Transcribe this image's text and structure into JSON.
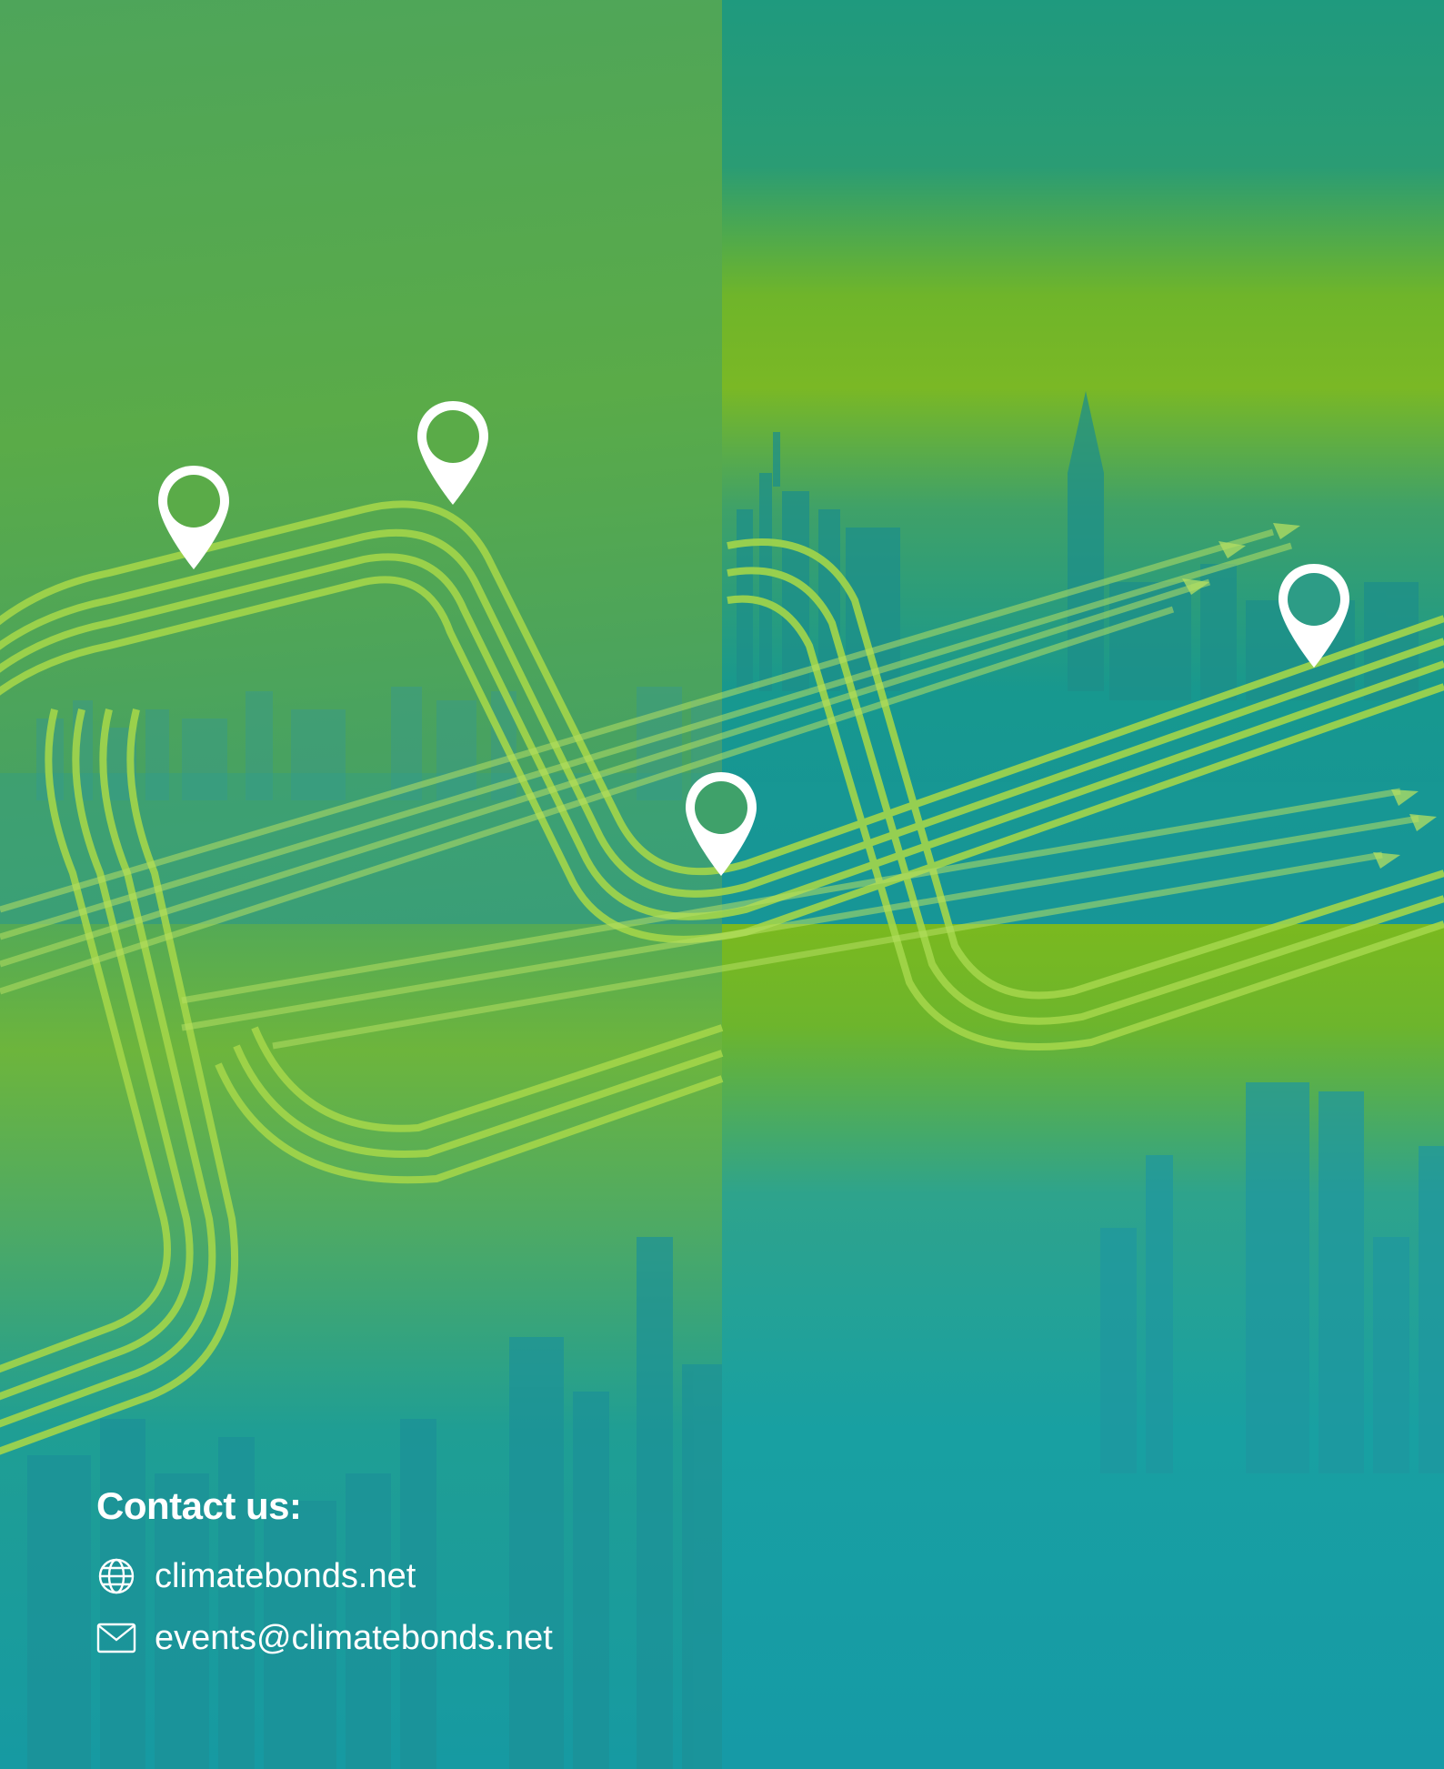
{
  "contact": {
    "title": "Contact us:",
    "website": "climatebonds.net",
    "email": "events@climatebonds.net",
    "website_icon": "globe-icon",
    "email_icon": "envelope-icon"
  },
  "map_pin_icon": "map-pin-icon",
  "colors": {
    "route_stroke": "#9fd44a",
    "pin": "#ffffff",
    "text": "#ffffff",
    "green_tint": "#5aab48",
    "teal_tint": "#17998f"
  }
}
